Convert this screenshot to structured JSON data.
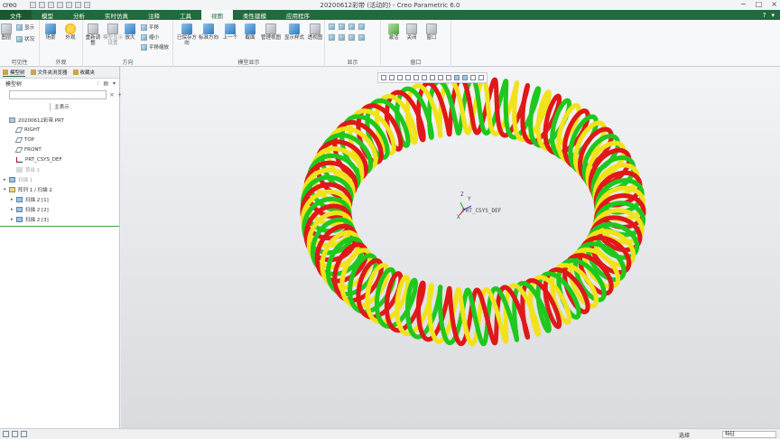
{
  "app": {
    "logo": "creo",
    "window_title": "20200612彩带 (活动的) - Creo Parametric 6.0",
    "window_controls": [
      "−",
      "□",
      "×"
    ]
  },
  "tabs": [
    {
      "label": "文件"
    },
    {
      "label": "模型"
    },
    {
      "label": "分析"
    },
    {
      "label": "实时仿真"
    },
    {
      "label": "注释"
    },
    {
      "label": "工具"
    },
    {
      "label": "视图"
    },
    {
      "label": "柔性建模"
    },
    {
      "label": "应用程序"
    }
  ],
  "active_tab": "视图",
  "tabs_right": [
    "?",
    "▾"
  ],
  "ribbon": {
    "groups": [
      {
        "title": "可见性",
        "buttons": [
          "显示",
          "状况",
          "图层"
        ]
      },
      {
        "title": "外观",
        "buttons": [
          "场景",
          "外观"
        ]
      },
      {
        "title": "方向",
        "buttons": [
          "重新调整",
          "模型显示设置",
          "放大",
          "平移",
          "缩小",
          "平移缩放"
        ]
      },
      {
        "title": "模型显示",
        "buttons": [
          "已保存方向",
          "标准方向",
          "上一个",
          "截面",
          "管理视图",
          "显示样式",
          "透视图"
        ]
      },
      {
        "title": "显示",
        "buttons": []
      },
      {
        "title": "窗口",
        "buttons": [
          "激活",
          "关闭",
          "窗口"
        ]
      }
    ]
  },
  "panel": {
    "tabs": [
      "模型树",
      "文件夹浏览器",
      "收藏夹"
    ],
    "tree_header": "模型树",
    "search_placeholder": "",
    "filter_label": "主表示",
    "tree_items": [
      {
        "label": "20200612彩带.PRT",
        "icon": "part-icon",
        "dim": false,
        "toggle": ""
      },
      {
        "label": "RIGHT",
        "icon": "plane-icon",
        "dim": false,
        "toggle": ""
      },
      {
        "label": "TOP",
        "icon": "plane-icon",
        "dim": false,
        "toggle": ""
      },
      {
        "label": "FRONT",
        "icon": "plane-icon",
        "dim": false,
        "toggle": ""
      },
      {
        "label": "PRT_CSYS_DEF",
        "icon": "csys-icon",
        "dim": false,
        "toggle": ""
      },
      {
        "label": "草绘 1",
        "icon": "sketch-icon",
        "dim": true,
        "toggle": ""
      },
      {
        "label": "扫描 1",
        "icon": "sweep-icon",
        "dim": true,
        "toggle": "▸"
      },
      {
        "label": "阵列 1 / 扫描 2",
        "icon": "pattern-icon",
        "dim": false,
        "toggle": "▾"
      },
      {
        "label": "扫描 2 [1]",
        "icon": "sweep-icon",
        "dim": false,
        "toggle": "▸"
      },
      {
        "label": "扫描 2 [2]",
        "icon": "sweep-icon",
        "dim": false,
        "toggle": "▸"
      },
      {
        "label": "扫描 2 [3]",
        "icon": "sweep-icon",
        "dim": false,
        "toggle": "▸"
      }
    ]
  },
  "canvas": {
    "csys_label": "PRT_CSYS_DEF",
    "axes": {
      "x": "X",
      "y": "Y",
      "z": "Z"
    },
    "helix_colors": [
      "#e01818",
      "#f2e21a",
      "#1ec81e"
    ]
  },
  "status": {
    "filter_value": "特征",
    "selection_label": "选择"
  }
}
